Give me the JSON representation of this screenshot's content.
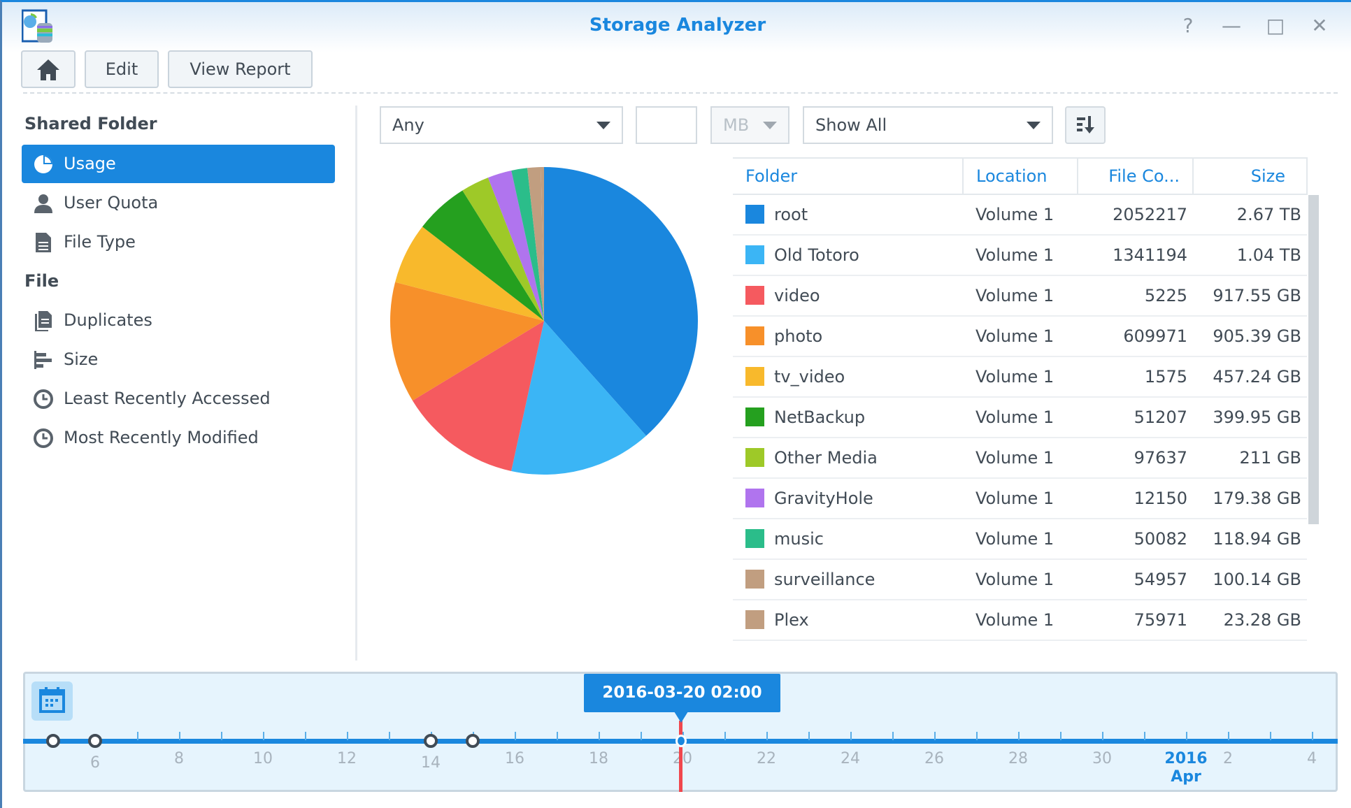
{
  "window": {
    "title": "Storage Analyzer",
    "controls": [
      "help-icon",
      "minimize-icon",
      "maximize-icon",
      "close-icon"
    ]
  },
  "toolbar": {
    "home_icon": "home-icon",
    "edit_label": "Edit",
    "report_label": "View Report"
  },
  "sidebar": {
    "shared_folder_heading": "Shared Folder",
    "shared_items": [
      {
        "label": "Usage",
        "icon": "pie-chart-icon",
        "selected": true
      },
      {
        "label": "User Quota",
        "icon": "user-icon"
      },
      {
        "label": "File Type",
        "icon": "document-icon"
      }
    ],
    "file_heading": "File",
    "file_items": [
      {
        "label": "Duplicates",
        "icon": "duplicate-icon"
      },
      {
        "label": "Size",
        "icon": "bars-icon"
      },
      {
        "label": "Least Recently Accessed",
        "icon": "clock-icon"
      },
      {
        "label": "Most Recently Modified",
        "icon": "clock-icon"
      }
    ]
  },
  "filters": {
    "type_select": "Any",
    "size_input": "",
    "unit_select": "MB",
    "show_select": "Show All",
    "sort_icon": "sort-descending-icon"
  },
  "table": {
    "headers": [
      "Folder",
      "Location",
      "File Co...",
      "Size"
    ],
    "rows": [
      {
        "folder": "root",
        "location": "Volume 1",
        "count": "2052217",
        "size": "2.67 TB",
        "color": "#1a87de"
      },
      {
        "folder": "Old Totoro",
        "location": "Volume 1",
        "count": "1341194",
        "size": "1.04 TB",
        "color": "#3bb5f5"
      },
      {
        "folder": "video",
        "location": "Volume 1",
        "count": "5225",
        "size": "917.55 GB",
        "color": "#f55a5f"
      },
      {
        "folder": "photo",
        "location": "Volume 1",
        "count": "609971",
        "size": "905.39 GB",
        "color": "#f7902a"
      },
      {
        "folder": "tv_video",
        "location": "Volume 1",
        "count": "1575",
        "size": "457.24 GB",
        "color": "#f8b92c"
      },
      {
        "folder": "NetBackup",
        "location": "Volume 1",
        "count": "51207",
        "size": "399.95 GB",
        "color": "#25a01f"
      },
      {
        "folder": "Other Media",
        "location": "Volume 1",
        "count": "97637",
        "size": "211 GB",
        "color": "#9ec928"
      },
      {
        "folder": "GravityHole",
        "location": "Volume 1",
        "count": "12150",
        "size": "179.38 GB",
        "color": "#b074ee"
      },
      {
        "folder": "music",
        "location": "Volume 1",
        "count": "50082",
        "size": "118.94 GB",
        "color": "#2bbd8a"
      },
      {
        "folder": "surveillance",
        "location": "Volume 1",
        "count": "54957",
        "size": "100.14 GB",
        "color": "#c19e80"
      },
      {
        "folder": "Plex",
        "location": "Volume 1",
        "count": "75971",
        "size": "23.28 GB",
        "color": "#c19e80"
      }
    ]
  },
  "timeline": {
    "calendar_icon": "calendar-icon",
    "selected": "2016-03-20 02:00",
    "labels": [
      "6",
      "8",
      "10",
      "12",
      "14",
      "16",
      "18",
      "20",
      "22",
      "24",
      "26",
      "28",
      "30",
      "2016",
      "Apr",
      "2",
      "4"
    ],
    "snapshot_days": [
      5,
      6,
      14,
      15
    ],
    "current_day": 20
  }
}
